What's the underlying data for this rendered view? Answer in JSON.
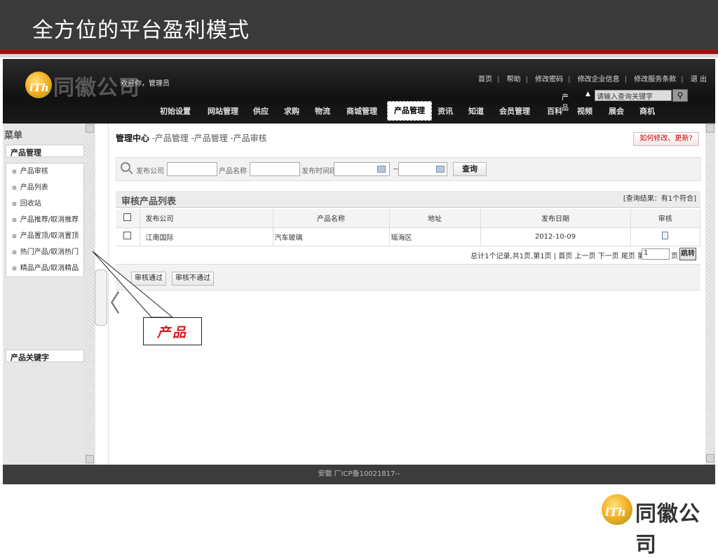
{
  "slide": {
    "title": "全方位的平台盈利模式"
  },
  "header": {
    "logo_ith": "iTh",
    "logo_name": "同徽公司",
    "welcome": "欢迎你，管理员",
    "toplinks": [
      "首页",
      "帮助",
      "修改密码",
      "修改企业信息",
      "修改服务条款",
      "退 出"
    ],
    "search_category": "产品",
    "search_placeholder": "请输入查询关键字",
    "search_btn_icon": "search-icon"
  },
  "nav": {
    "items": [
      "初始设置",
      "网站管理",
      "供应",
      "求购",
      "物流",
      "商城管理",
      "产品管理",
      "资讯",
      "知道",
      "会员管理",
      "百科",
      "视频",
      "展会",
      "商机"
    ],
    "active": "产品管理"
  },
  "sidebar": {
    "menu_title": "菜单",
    "section_1": "产品管理",
    "items": [
      "产品审核",
      "产品列表",
      "回收站",
      "产品推荐/取消推荐",
      "产品置顶/取消置顶",
      "热门产品/取消热门",
      "精品产品/取消精品"
    ],
    "section_2": "产品关键字"
  },
  "breadcrumb": {
    "root": "管理中心",
    "p1": " -产品管理",
    "p2": " -产品管理",
    "p3": " -产品审核"
  },
  "help_button": "如何修改、更新?",
  "filter": {
    "company_label": "发布公司",
    "product_label": "产品名称",
    "time_label": "发布时间段",
    "tilde": "~",
    "query_btn": "查询"
  },
  "list": {
    "title": "审核产品列表",
    "result": "[查询结果：有1个符合]",
    "columns": [
      "发布公司",
      "产品名称",
      "地址",
      "发布日期",
      "审核"
    ],
    "rows": [
      {
        "company": "江南国际",
        "product": "汽车玻璃",
        "address": "瑶海区",
        "date": "2012-10-09"
      }
    ]
  },
  "pager": {
    "text": "总计1个记录,共1页,第1页 | 首页 上一页 下一页 尾页 第",
    "page_value": "1",
    "suffix": "页",
    "go_btn": "跳转"
  },
  "actions": {
    "approve": "审核通过",
    "reject": "审核不通过"
  },
  "footer": {
    "text": "安徽 厂ICP备10021817--"
  },
  "callout": {
    "text": "产品"
  },
  "brand": {
    "ith": "iTh",
    "name": "同徽公司"
  }
}
